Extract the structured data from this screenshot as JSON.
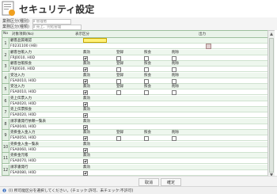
{
  "header": {
    "title": "セキュリティ設定"
  },
  "meta": [
    {
      "label": "業務区分(種別)",
      "value": "0 管理者"
    },
    {
      "label": "業務区分(種類)",
      "value": "0 売上、完結管理"
    }
  ],
  "columns": [
    "No",
    "対象項目(No)",
    "表示区分",
    "出力"
  ],
  "option_labels": [
    "無効",
    "登録",
    "照会",
    "削除"
  ],
  "rows": [
    {
      "num": "1",
      "name": "顧客品質確認",
      "code": "F0231100 (HB)",
      "opts": []
    },
    {
      "num": "2",
      "name": "顧客台帳入力",
      "code": "FRJ0010, H0D",
      "opts": [
        true,
        false,
        false,
        false
      ]
    },
    {
      "num": "3",
      "name": "顧客台帳照会",
      "code": "FRJ0030, H0D",
      "opts": [
        true,
        false,
        false,
        false
      ]
    },
    {
      "num": "4",
      "name": "受注入力",
      "code": "FSA0010, H0D",
      "opts": [
        true,
        false,
        false,
        false
      ]
    },
    {
      "num": "5",
      "name": "受注入力",
      "code": "FSA0010, H0D",
      "opts": [
        true,
        false,
        false,
        false
      ]
    },
    {
      "num": "6",
      "name": "売上伝票入力",
      "code": "FSA0020, H0D",
      "opts": [
        true
      ]
    },
    {
      "num": "7",
      "name": "売上伝票照会",
      "code": "FSA0020, H0D",
      "opts": [
        true
      ]
    },
    {
      "num": "8",
      "name": "請求書発行依頼一覧表",
      "code": "FSA0040, H0D",
      "opts": [
        true
      ]
    },
    {
      "num": "9",
      "name": "売掛金入金入力",
      "code": "FSA0050, H0D",
      "opts": [
        true,
        false,
        false,
        false
      ]
    },
    {
      "num": "10",
      "name": "売掛金入金一覧表",
      "code": "FSA0060, H0D",
      "opts": [
        true
      ]
    },
    {
      "num": "11",
      "name": "売掛金元帳",
      "code": "FSA0070, H0D",
      "opts": [
        true
      ]
    },
    {
      "num": "12",
      "name": "請求書発行",
      "code": "FSA0080, H0D",
      "opts": [
        true
      ]
    }
  ],
  "buttons": {
    "cancel": "取消",
    "confirm": "確定"
  },
  "status": "(i) 所可能区分を選択してください。(チェック:許可、未チェック:不許可)"
}
